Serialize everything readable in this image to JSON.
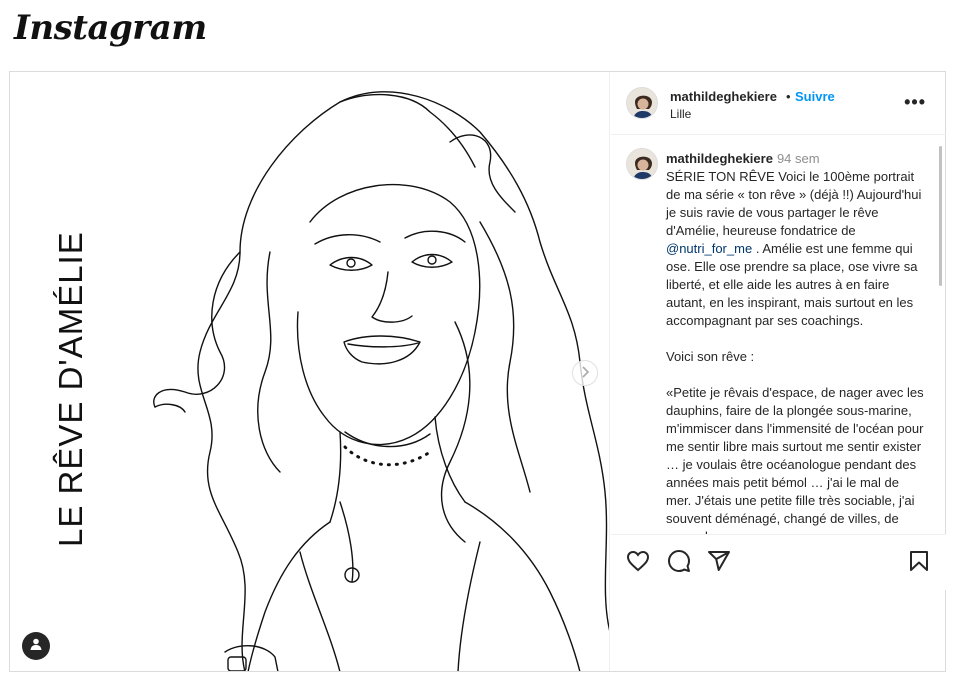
{
  "app": {
    "logo_text": "Instagram"
  },
  "post": {
    "image": {
      "vertical_title": "LE RÊVE D'AMÉLIE",
      "next_icon": "chevron-right-icon",
      "user_tag_icon": "person-icon"
    },
    "header": {
      "username": "mathildeghekiere",
      "separator": "•",
      "follow_label": "Suivre",
      "location": "Lille",
      "more_icon": "more-horizontal-icon",
      "more_label": "•••"
    },
    "caption": {
      "username": "mathildeghekiere",
      "time": "94 sem",
      "intro": "SÉRIE TON RÊVE Voici le 100ème portrait de ma série « ton rêve » (déjà !!) Aujourd'hui je suis ravie de vous partager le rêve d'Amélie, heureuse fondatrice de",
      "mention": "@nutri_for_me",
      "after_mention": ". Amélie est une femme qui ose. Elle ose prendre sa place, ose vivre sa liberté, et elle aide les autres à en faire autant, en les inspirant, mais surtout en les accompagnant par ses coachings.",
      "para2": "Voici son rêve :",
      "para3": "«Petite je rêvais d'espace, de nager avec les dauphins, faire de la plongée sous-marine, m'immiscer dans l'immensité de l'océan pour me sentir libre mais surtout me sentir exister … je voulais être océanologue pendant des années mais petit bémol … j'ai le mal de mer. J'étais une petite fille très sociable, j'ai souvent déménagé, changé de villes, de pays, de"
    },
    "actions": {
      "like_icon": "heart-icon",
      "comment_icon": "comment-icon",
      "share_icon": "paper-plane-icon",
      "save_icon": "bookmark-icon"
    }
  }
}
